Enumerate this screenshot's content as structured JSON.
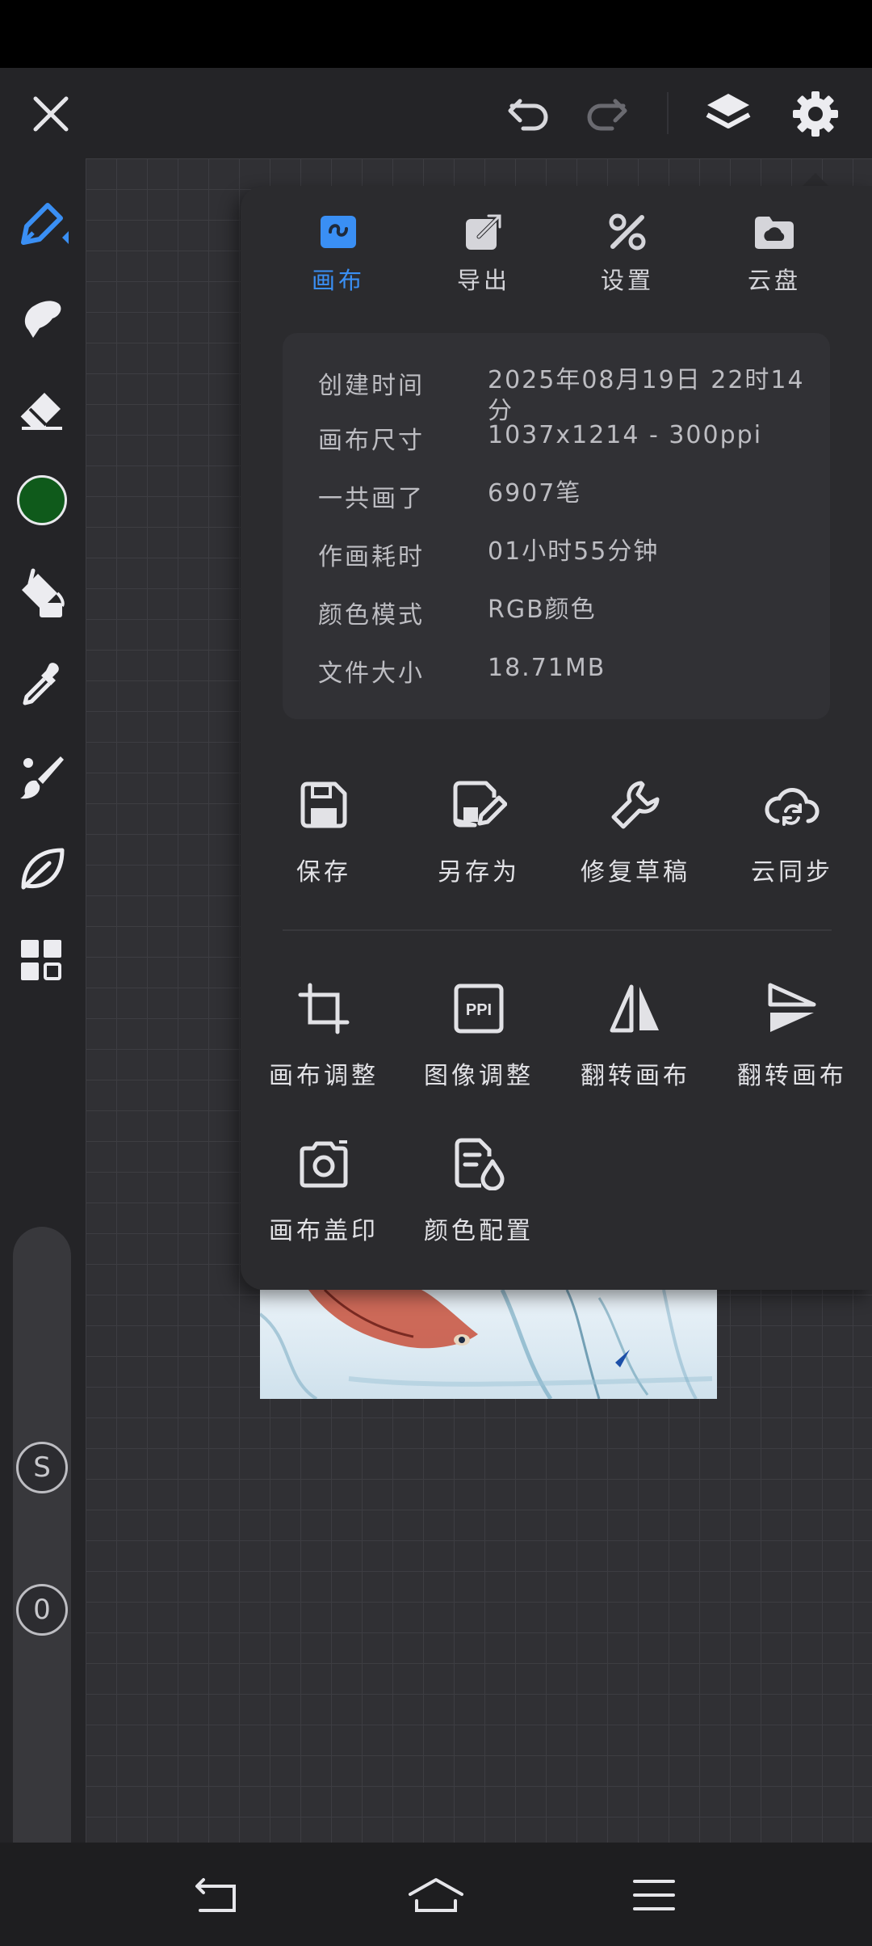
{
  "toolbar": {
    "close_icon": "close-icon",
    "undo_icon": "undo-icon",
    "redo_icon": "redo-icon",
    "layers_icon": "layers-icon",
    "settings_icon": "gear-icon"
  },
  "side_toolbar": {
    "tools": [
      "brush-tool",
      "smudge-tool",
      "eraser-tool",
      "color-picker",
      "fill-tool",
      "eyedropper-tool",
      "paint-brush-tool",
      "leaf-tool",
      "grid-tool"
    ],
    "current_color": "#0f5a1b",
    "slider_s_label": "S",
    "slider_o_label": "0"
  },
  "popup": {
    "tabs": [
      {
        "label": "画布",
        "active": true
      },
      {
        "label": "导出",
        "active": false
      },
      {
        "label": "设置",
        "active": false
      },
      {
        "label": "云盘",
        "active": false
      }
    ],
    "info": [
      {
        "label": "创建时间",
        "value": "2025年08月19日 22时14分"
      },
      {
        "label": "画布尺寸",
        "value": "1037x1214 - 300ppi"
      },
      {
        "label": "一共画了",
        "value": "6907笔"
      },
      {
        "label": "作画耗时",
        "value": "01小时55分钟"
      },
      {
        "label": "颜色模式",
        "value": "RGB颜色"
      },
      {
        "label": "文件大小",
        "value": "18.71MB"
      }
    ],
    "file_actions": [
      {
        "label": "保存"
      },
      {
        "label": "另存为"
      },
      {
        "label": "修复草稿"
      },
      {
        "label": "云同步"
      }
    ],
    "canvas_actions": [
      {
        "label": "画布调整"
      },
      {
        "label": "图像调整",
        "icon_text": "PPI"
      },
      {
        "label": "翻转画布"
      },
      {
        "label": "翻转画布"
      },
      {
        "label": "画布盖印"
      },
      {
        "label": "颜色配置"
      }
    ]
  },
  "colors": {
    "accent": "#3a8ff4",
    "panel": "#2b2b2e",
    "card": "#313135"
  },
  "nav": {
    "back_icon": "back-icon",
    "home_icon": "home-icon",
    "menu_icon": "menu-icon"
  }
}
